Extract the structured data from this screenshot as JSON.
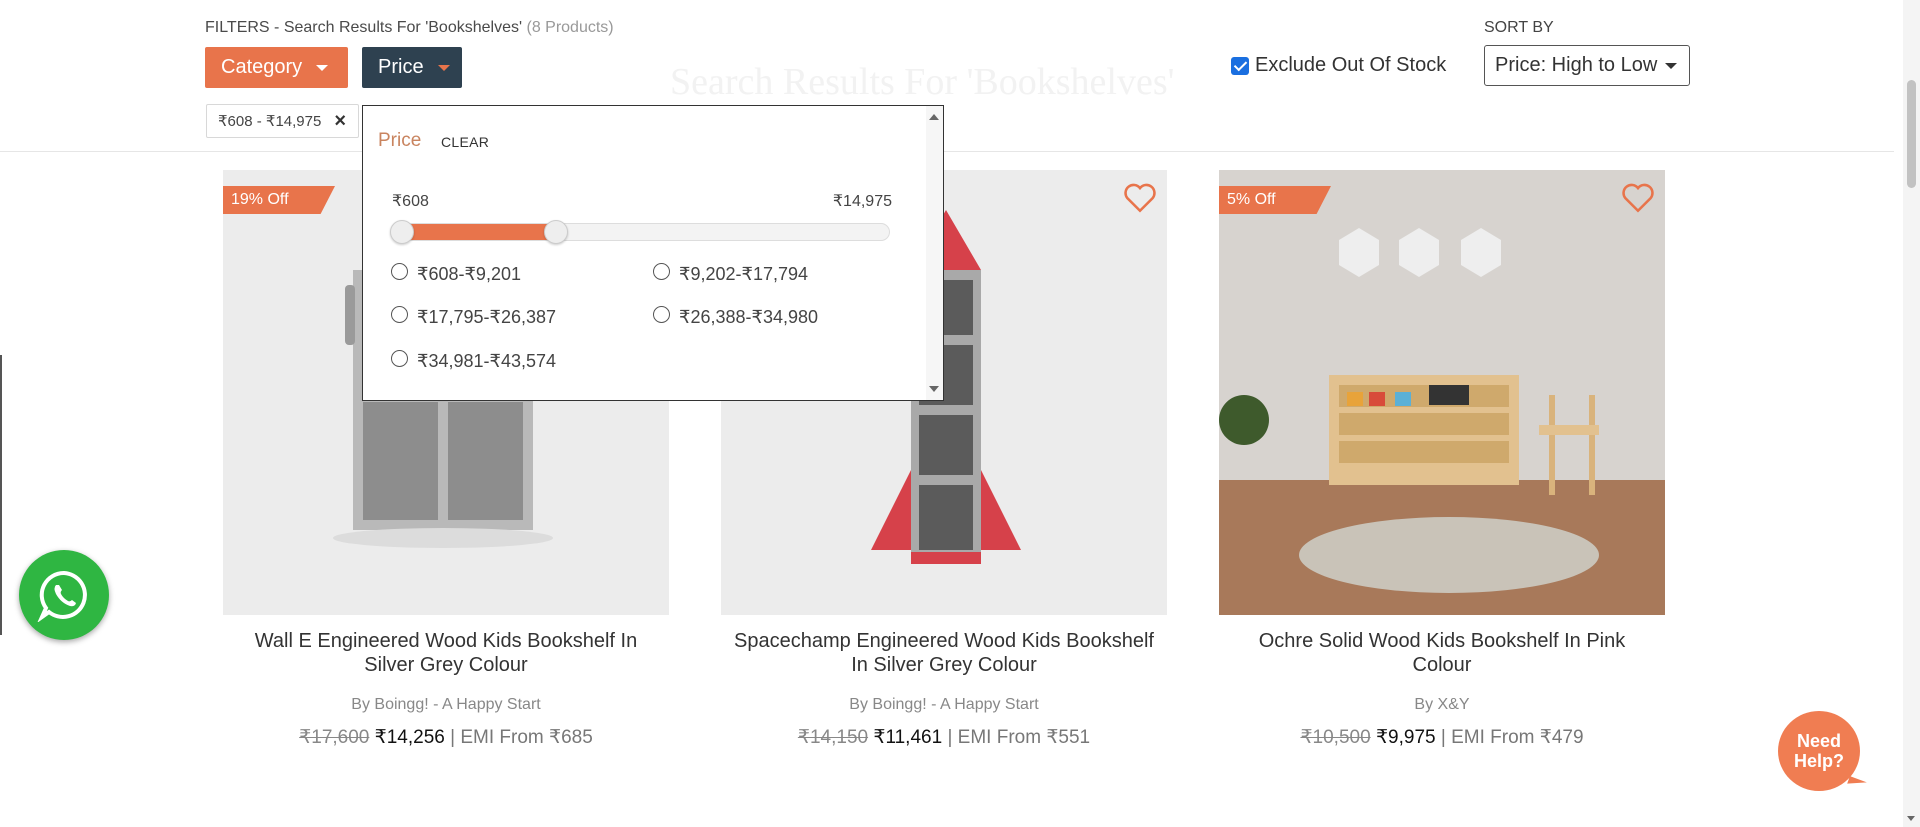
{
  "filters": {
    "heading": "FILTERS - Search Results For 'Bookshelves'",
    "count": "(8 Products)",
    "category_label": "Category",
    "price_label": "Price",
    "active_chip": "₹608 - ₹14,975"
  },
  "background_heading": "Search Results For 'Bookshelves'",
  "exclude_out_of_stock": {
    "label": "Exclude Out Of Stock",
    "checked": true
  },
  "sort": {
    "label": "SORT BY",
    "selected": "Price: High to Low"
  },
  "price_dropdown": {
    "title": "Price",
    "clear_label": "CLEAR",
    "range_min_label": "₹608",
    "range_max_label": "₹14,975",
    "selected_low_fraction": 0.0,
    "selected_high_fraction": 0.33,
    "options": [
      "₹608-₹9,201",
      "₹9,202-₹17,794",
      "₹17,795-₹26,387",
      "₹26,388-₹34,980",
      "₹34,981-₹43,574"
    ]
  },
  "products": [
    {
      "badge": "19% Off",
      "title": "Wall E Engineered Wood Kids Bookshelf In Silver Grey Colour",
      "brand": "By Boingg! - A Happy Start",
      "mrp": "₹17,600",
      "price": "₹14,256",
      "emi": "| EMI From ₹685"
    },
    {
      "badge": "",
      "title": "Spacechamp Engineered Wood Kids Bookshelf In Silver Grey Colour",
      "brand": "By Boingg! - A Happy Start",
      "mrp": "₹14,150",
      "price": "₹11,461",
      "emi": "| EMI From ₹551"
    },
    {
      "badge": "5% Off",
      "title": "Ochre Solid Wood Kids Bookshelf In Pink Colour",
      "brand": "By X&Y",
      "mrp": "₹10,500",
      "price": "₹9,975",
      "emi": "| EMI From ₹479"
    }
  ],
  "help_widget": {
    "line1": "Need",
    "line2": "Help?"
  },
  "colors": {
    "accent": "#e8744b",
    "dark_button": "#2e4150",
    "whatsapp": "#2fb642"
  },
  "icons": [
    "caret-down-icon",
    "close-icon",
    "heart-icon",
    "whatsapp-icon",
    "checkbox-checked-icon"
  ]
}
